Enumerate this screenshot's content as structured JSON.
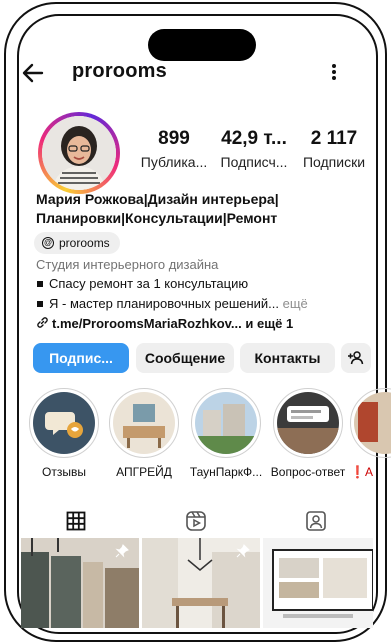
{
  "header": {
    "username": "prorooms"
  },
  "stats": [
    {
      "value": "899",
      "label": "Публика..."
    },
    {
      "value": "42,9 т...",
      "label": "Подписч..."
    },
    {
      "value": "2 117",
      "label": "Подписки"
    }
  ],
  "bio": {
    "name_line1": "Мария Рожкова|Дизайн интерьера|",
    "name_line2": "Планировки|Консультации|Ремонт",
    "threads": "prorooms",
    "category": "Студия интерьерного дизайна",
    "line1": "Спасу ремонт за 1 консультацию",
    "line2": "Я - мастер планировочных решений...",
    "line2_more": " ещё",
    "link": "t.me/ProroomsMariaRozhkov... и ещё 1"
  },
  "buttons": {
    "follow": "Подпис...",
    "message": "Сообщение",
    "contacts": "Контакты"
  },
  "highlights": [
    {
      "label": "Отзывы"
    },
    {
      "label": "АПГРЕЙД"
    },
    {
      "label": "ТаунПаркФ..."
    },
    {
      "label": "Вопрос-ответ"
    },
    {
      "label": "❗А"
    }
  ],
  "colors": {
    "accent": "#3797f0",
    "button_bg": "#efefef",
    "muted": "#737373"
  }
}
